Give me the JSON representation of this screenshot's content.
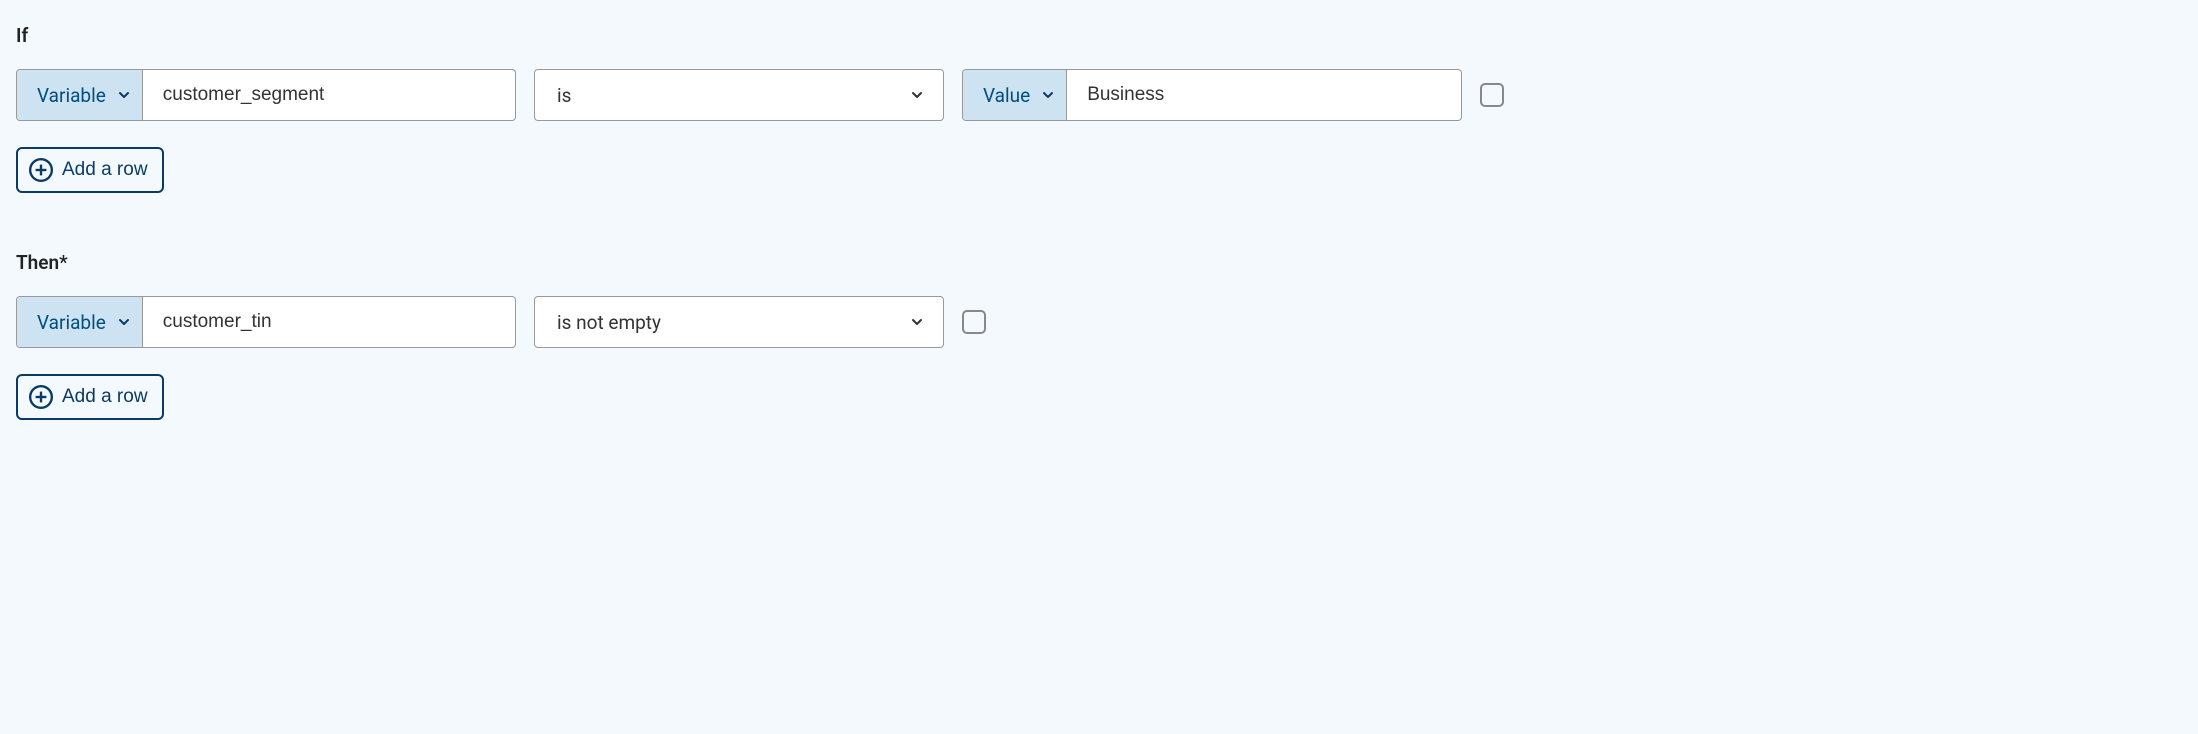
{
  "if": {
    "label": "If",
    "row": {
      "left_type_label": "Variable",
      "left_value": "customer_segment",
      "operator": "is",
      "right_type_label": "Value",
      "right_value": "Business"
    },
    "add_row_label": "Add a row"
  },
  "then": {
    "label": "Then*",
    "row": {
      "left_type_label": "Variable",
      "left_value": "customer_tin",
      "operator": "is not empty"
    },
    "add_row_label": "Add a row"
  }
}
